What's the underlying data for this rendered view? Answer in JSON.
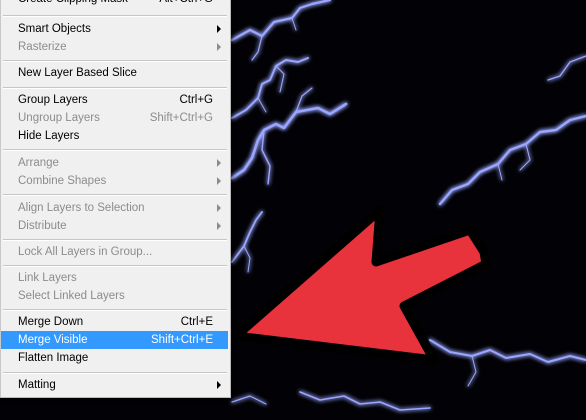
{
  "menu": {
    "items": {
      "create_clipping_mask": {
        "label": "Create Clipping Mask",
        "shortcut": "Alt+Ctrl+G"
      },
      "smart_objects": {
        "label": "Smart Objects"
      },
      "rasterize": {
        "label": "Rasterize"
      },
      "new_layer_based_slice": {
        "label": "New Layer Based Slice"
      },
      "group_layers": {
        "label": "Group Layers",
        "shortcut": "Ctrl+G"
      },
      "ungroup_layers": {
        "label": "Ungroup Layers",
        "shortcut": "Shift+Ctrl+G"
      },
      "hide_layers": {
        "label": "Hide Layers"
      },
      "arrange": {
        "label": "Arrange"
      },
      "combine_shapes": {
        "label": "Combine Shapes"
      },
      "align_layers": {
        "label": "Align Layers to Selection"
      },
      "distribute": {
        "label": "Distribute"
      },
      "lock_all_layers": {
        "label": "Lock All Layers in Group..."
      },
      "link_layers": {
        "label": "Link Layers"
      },
      "select_linked_layers": {
        "label": "Select Linked Layers"
      },
      "merge_down": {
        "label": "Merge Down",
        "shortcut": "Ctrl+E"
      },
      "merge_visible": {
        "label": "Merge Visible",
        "shortcut": "Shift+Ctrl+E"
      },
      "flatten_image": {
        "label": "Flatten Image"
      },
      "matting": {
        "label": "Matting"
      }
    },
    "highlighted": "Merge Visible"
  },
  "colors": {
    "menu_bg": "#f0f0f0",
    "highlight": "#3399ff",
    "disabled_text": "#8c8c8c",
    "annotation_arrow": "#e8323c",
    "lightning": "#a9b4ff"
  },
  "icons": {
    "submenu": "chevron-right-icon",
    "annotation": "red-arrow-icon"
  }
}
